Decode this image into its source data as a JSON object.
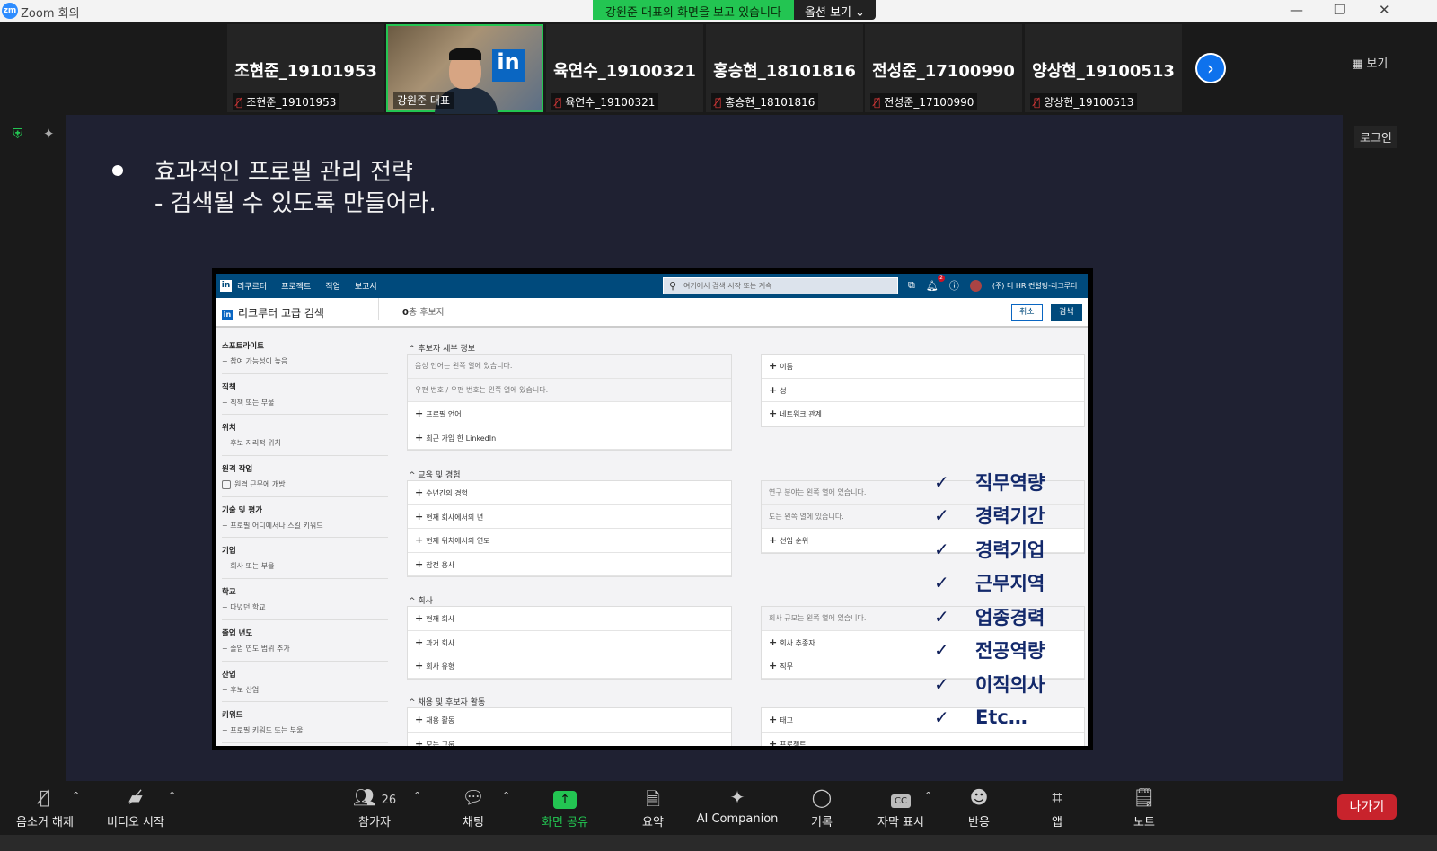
{
  "window": {
    "app_title": "Zoom 회의",
    "logo": "zm",
    "share_message": "강원준 대표의 화면을 보고 있습니다",
    "view_options": "옵션 보기",
    "view_label": "보기",
    "login_label": "로그인"
  },
  "participants": [
    {
      "big": "조현준_19101953",
      "small": "조현준_19101953"
    },
    {
      "big": "",
      "small": "강원준 대표"
    },
    {
      "big": "육연수_19100321",
      "small": "육연수_19100321"
    },
    {
      "big": "홍승현_18101816",
      "small": "홍승현_18101816"
    },
    {
      "big": "전성준_17100990",
      "small": "전성준_17100990"
    },
    {
      "big": "양상현_19100513",
      "small": "양상현_19100513"
    }
  ],
  "slide": {
    "line1": "효과적인 프로필 관리 전략",
    "line2": "- 검색될 수 있도록 만들어라."
  },
  "linkedin": {
    "nav": [
      "리쿠르터",
      "프로젝트",
      "직업",
      "보고서"
    ],
    "search_placeholder": "여기에서 검색 시작 또는 계속",
    "notif_count": "2",
    "company": "(주) 더 HR 컨설팅-리크루터",
    "page_title": "리크루터 고급 검색",
    "count_num": "0",
    "count_label": "총 후보자",
    "cancel": "취소",
    "search": "검색",
    "sidebar": [
      {
        "h": "스포트라이트",
        "a": "+ 참여 가능성이 높음"
      },
      {
        "h": "직책",
        "a": "+ 직책 또는 부울"
      },
      {
        "h": "위치",
        "a": "+ 후보 지리적 위치"
      },
      {
        "h": "원격 작업",
        "a": "원격 근무에 개방"
      },
      {
        "h": "기술 및 평가",
        "a": "+ 프로필 어디에서나 스킬 키워드"
      },
      {
        "h": "기업",
        "a": "+ 회사 또는 부울"
      },
      {
        "h": "학교",
        "a": "+ 다녔던 학교"
      },
      {
        "h": "졸업 년도",
        "a": "+ 졸업 연도 범위 추가"
      },
      {
        "h": "산업",
        "a": "+ 후보 산업"
      },
      {
        "h": "키워드",
        "a": "+ 프로필 키워드 또는 부울"
      }
    ],
    "sections": [
      {
        "title": "^ 후보자 세부 정보",
        "left": [
          {
            "t": "음성 언어는 왼쪽 열에 있습니다.",
            "g": true
          },
          {
            "t": "우편 번호 / 우편 번호는 왼쪽 열에 있습니다.",
            "g": true
          },
          {
            "t": "프로필 언어"
          },
          {
            "t": "최근 가입 한 LinkedIn"
          }
        ],
        "right": [
          {
            "t": "이름"
          },
          {
            "t": "성"
          },
          {
            "t": "네트워크 관계"
          }
        ]
      },
      {
        "title": "^ 교육 및 경험",
        "left": [
          {
            "t": "수년간의 경험"
          },
          {
            "t": "현재 회사에서의 년"
          },
          {
            "t": "현재 위치에서의 연도"
          },
          {
            "t": "참전 용사"
          }
        ],
        "right": [
          {
            "t": "연구 분야는 왼쪽 열에 있습니다.",
            "g": true
          },
          {
            "t": "도는 왼쪽 열에 있습니다.",
            "g": true
          },
          {
            "t": "선임 순위"
          }
        ]
      },
      {
        "title": "^ 회사",
        "left": [
          {
            "t": "현재 회사"
          },
          {
            "t": "과거 회사"
          },
          {
            "t": "회사 유형"
          }
        ],
        "right": [
          {
            "t": "회사 규모는 왼쪽 열에 있습니다.",
            "g": true
          },
          {
            "t": "회사 추종자"
          },
          {
            "t": "직무"
          }
        ]
      },
      {
        "title": "^ 채용 및 후보자 활동",
        "left": [
          {
            "t": "채용 활동"
          },
          {
            "t": "모든 그룹"
          }
        ],
        "right": [
          {
            "t": "태그"
          },
          {
            "t": "프로젝트"
          }
        ]
      }
    ]
  },
  "checklist": [
    "직무역량",
    "경력기간",
    "경력기업",
    "근무지역",
    "업종경력",
    "전공역량",
    "이직의사",
    "Etc…"
  ],
  "toolbar": {
    "mute": "음소거 해제",
    "video": "비디오 시작",
    "participants": "참가자",
    "participant_count": "26",
    "chat": "채팅",
    "share": "화면 공유",
    "summary": "요약",
    "ai": "AI Companion",
    "record": "기록",
    "captions": "자막 표시",
    "reactions": "반응",
    "apps": "앱",
    "notes": "노트",
    "leave": "나가기"
  }
}
